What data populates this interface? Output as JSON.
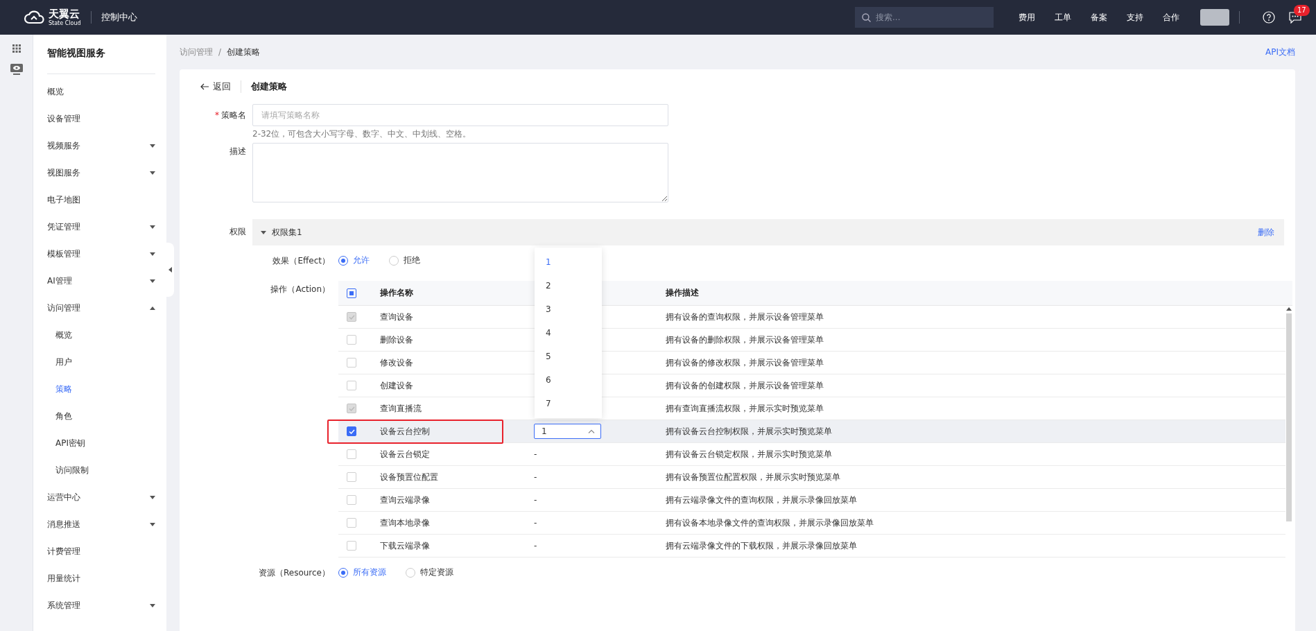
{
  "topbar": {
    "brand": "天翼云",
    "brand_sub": "State Cloud",
    "console": "控制中心",
    "search": {
      "placeholder": "搜索..."
    },
    "nav": [
      "费用",
      "工单",
      "备案",
      "支持",
      "合作"
    ],
    "badge": "17"
  },
  "sidebar": {
    "title": "智能视图服务",
    "items": [
      {
        "label": "概览",
        "kind": "link",
        "selected": false
      },
      {
        "label": "设备管理",
        "kind": "link",
        "selected": false
      },
      {
        "label": "视频服务",
        "kind": "group",
        "expanded": false,
        "selected": false
      },
      {
        "label": "视图服务",
        "kind": "group",
        "expanded": false,
        "selected": false
      },
      {
        "label": "电子地图",
        "kind": "link",
        "selected": false
      },
      {
        "label": "凭证管理",
        "kind": "group",
        "expanded": false,
        "selected": false
      },
      {
        "label": "模板管理",
        "kind": "group",
        "expanded": false,
        "selected": false
      },
      {
        "label": "AI管理",
        "kind": "group",
        "expanded": false,
        "selected": false
      },
      {
        "label": "访问管理",
        "kind": "group",
        "expanded": true,
        "selected": false,
        "children": [
          {
            "label": "概览",
            "selected": false
          },
          {
            "label": "用户",
            "selected": false
          },
          {
            "label": "策略",
            "selected": true
          },
          {
            "label": "角色",
            "selected": false
          },
          {
            "label": "API密钥",
            "selected": false
          },
          {
            "label": "访问限制",
            "selected": false
          }
        ]
      },
      {
        "label": "运营中心",
        "kind": "group",
        "expanded": false,
        "selected": false
      },
      {
        "label": "消息推送",
        "kind": "group",
        "expanded": false,
        "selected": false
      },
      {
        "label": "计费管理",
        "kind": "link",
        "selected": false
      },
      {
        "label": "用量统计",
        "kind": "link",
        "selected": false
      },
      {
        "label": "系统管理",
        "kind": "group",
        "expanded": false,
        "selected": false
      }
    ]
  },
  "breadcrumb": [
    "访问管理",
    "创建策略"
  ],
  "breadcrumb_separator": "/",
  "api_doc": "API文档",
  "header": {
    "back": "返回",
    "title": "创建策略"
  },
  "form": {
    "name": {
      "label": "策略名",
      "required_mark": "*",
      "placeholder": "请填写策略名称",
      "hint": "2-32位，可包含大小写字母、数字、中文、中划线、空格。"
    },
    "description": {
      "label": "描述"
    },
    "permissions_label": "权限"
  },
  "permission_set": {
    "title": "权限集1",
    "expanded": true,
    "delete": "删除",
    "effect": {
      "label": "效果（Effect）",
      "options": [
        {
          "label": "允许",
          "selected": true
        },
        {
          "label": "拒绝",
          "selected": false
        }
      ]
    },
    "action": {
      "label": "操作（Action）",
      "header_indeterminate": true,
      "columns": [
        "操作名称",
        "操作描述"
      ],
      "rows": [
        {
          "name": "查询设备",
          "checked": true,
          "disabled": true,
          "highlighted": false,
          "description": "拥有设备的查询权限，并展示设备管理菜单"
        },
        {
          "name": "删除设备",
          "checked": false,
          "disabled": false,
          "highlighted": false,
          "description": "拥有设备的删除权限，并展示设备管理菜单"
        },
        {
          "name": "修改设备",
          "checked": false,
          "disabled": false,
          "highlighted": false,
          "description": "拥有设备的修改权限，并展示设备管理菜单"
        },
        {
          "name": "创建设备",
          "checked": false,
          "disabled": false,
          "highlighted": false,
          "description": "拥有设备的创建权限，并展示设备管理菜单"
        },
        {
          "name": "查询直播流",
          "checked": true,
          "disabled": true,
          "highlighted": false,
          "description": "拥有查询直播流权限，并展示实时预览菜单"
        },
        {
          "name": "设备云台控制",
          "checked": true,
          "disabled": false,
          "highlighted": true,
          "select": {
            "value": "1",
            "open": true,
            "options": [
              {
                "label": "1",
                "selected": true
              },
              {
                "label": "2",
                "selected": false
              },
              {
                "label": "3",
                "selected": false
              },
              {
                "label": "4",
                "selected": false
              },
              {
                "label": "5",
                "selected": false
              },
              {
                "label": "6",
                "selected": false
              },
              {
                "label": "7",
                "selected": false
              }
            ]
          },
          "description": "拥有设备云台控制权限，并展示实时预览菜单"
        },
        {
          "name": "设备云台锁定",
          "checked": false,
          "disabled": false,
          "highlighted": false,
          "column_3": "-",
          "description": "拥有设备云台锁定权限，并展示实时预览菜单"
        },
        {
          "name": "设备预置位配置",
          "checked": false,
          "disabled": false,
          "highlighted": false,
          "column_3": "-",
          "description": "拥有设备预置位配置权限，并展示实时预览菜单"
        },
        {
          "name": "查询云端录像",
          "checked": false,
          "disabled": false,
          "highlighted": false,
          "column_3": "-",
          "description": "拥有云端录像文件的查询权限，并展示录像回放菜单"
        },
        {
          "name": "查询本地录像",
          "checked": false,
          "disabled": false,
          "highlighted": false,
          "column_3": "-",
          "description": "拥有设备本地录像文件的查询权限，并展示录像回放菜单"
        },
        {
          "name": "下载云端录像",
          "checked": false,
          "disabled": false,
          "highlighted": false,
          "column_3": "-",
          "description": "拥有云端录像文件的下载权限，并展示录像回放菜单"
        }
      ]
    },
    "resource": {
      "label": "资源（Resource）",
      "options": [
        {
          "label": "所有资源",
          "selected": true
        },
        {
          "label": "特定资源",
          "selected": false
        }
      ]
    }
  }
}
